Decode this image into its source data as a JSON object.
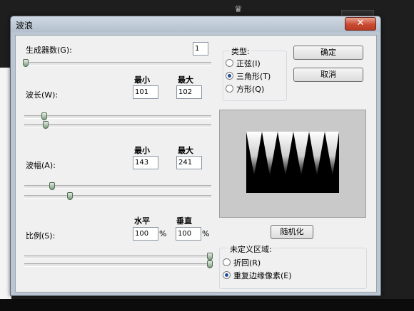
{
  "dialog": {
    "title": "波浪",
    "close_glyph": "✕"
  },
  "generators": {
    "label": "生成器数(G):",
    "value": "1",
    "level": 0
  },
  "wavelength": {
    "label": "波长(W):",
    "min_header": "最小",
    "max_header": "最大",
    "min": "101",
    "max": "102",
    "min_level": 0.1,
    "max_level": 0.1
  },
  "amplitude": {
    "label": "波幅(A):",
    "min_header": "最小",
    "max_header": "最大",
    "min": "143",
    "max": "241",
    "min_level": 0.15,
    "max_level": 0.24
  },
  "scale": {
    "label": "比例(S):",
    "h_header": "水平",
    "v_header": "垂直",
    "h": "100",
    "v": "100",
    "unit": "%",
    "h_level": 1.0,
    "v_level": 1.0
  },
  "type_group": {
    "title": "类型:",
    "options": [
      "正弦(I)",
      "三角形(T)",
      "方形(Q)"
    ],
    "selected": 1
  },
  "buttons": {
    "ok": "确定",
    "cancel": "取消",
    "randomize": "随机化"
  },
  "undefined_area": {
    "title": "未定义区域:",
    "options": [
      "折回(R)",
      "重复边缘像素(E)"
    ],
    "selected": 1
  }
}
